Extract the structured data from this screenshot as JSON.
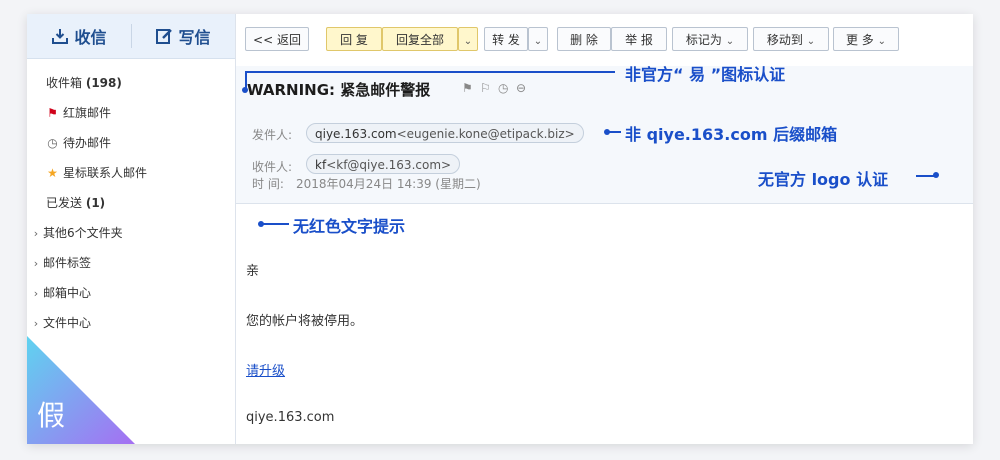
{
  "sidebar": {
    "receive_label": "收信",
    "write_label": "写信",
    "folders": [
      {
        "label": "收件箱",
        "count": "(198)",
        "icon": "none"
      },
      {
        "label": "红旗邮件",
        "count": "",
        "icon": "red-flag-icon"
      },
      {
        "label": "待办邮件",
        "count": "",
        "icon": "clock-icon"
      },
      {
        "label": "星标联系人邮件",
        "count": "",
        "icon": "star-icon"
      },
      {
        "label": "已发送",
        "count": "(1)",
        "icon": "none"
      }
    ],
    "groups": [
      "其他6个文件夹",
      "邮件标签",
      "邮箱中心",
      "文件中心"
    ],
    "fake_badge": "假",
    "fake_badge_colors": [
      "#5fd3f0",
      "#a56ff2"
    ]
  },
  "toolbar": {
    "back_label": "<< 返回",
    "reply_label": "回 复",
    "reply_all_label": "回复全部",
    "forward_label": "转 发",
    "delete_label": "删 除",
    "report_label": "举 报",
    "mark_label": "标记为",
    "move_label": "移动到",
    "more_label": "更 多"
  },
  "email": {
    "subject": "WARNING: 紧急邮件警报",
    "from_label": "发件人:",
    "from_name": "qiye.163.com",
    "from_address": "<eugenie.kone@etipack.biz>",
    "to_label": "收件人:",
    "to_name": "kf",
    "to_address": "<kf@qiye.163.com>",
    "time_label": "时   间:",
    "time_value": "2018年04月24日 14:39 (星期二)",
    "greeting": "亲",
    "body_line": "您的帐户将被停用。",
    "link_text": "请升级",
    "signature": "qiye.163.com"
  },
  "annotations": {
    "no_official_icon": "非官方“ 易 ”图标认证",
    "non_official_suffix": "非 qiye.163.com 后缀邮箱",
    "no_logo": "无官方 logo 认证",
    "no_red_text": "无红色文字提示",
    "accent_color": "#1a4fc9"
  }
}
